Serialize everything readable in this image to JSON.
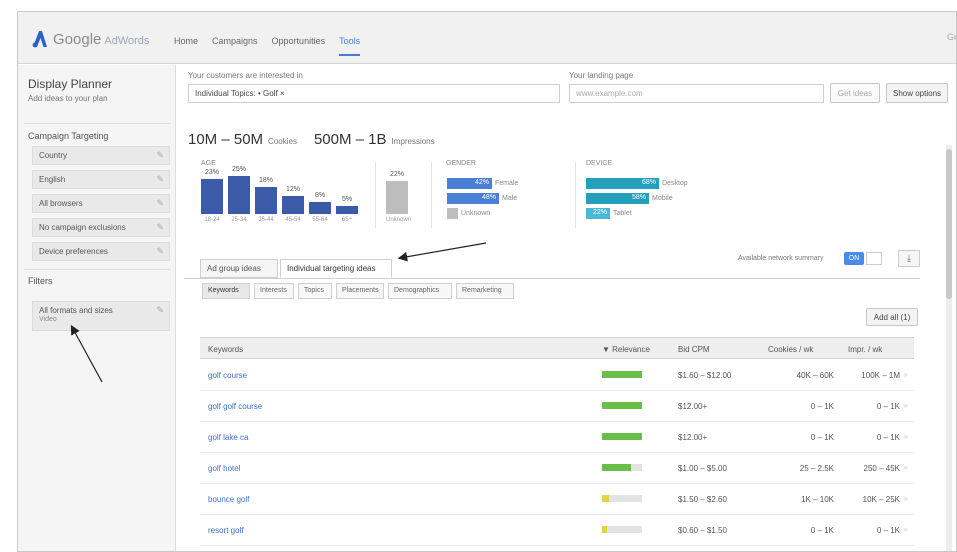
{
  "app": {
    "logo_main": "Google",
    "logo_sub": "AdWords",
    "user": "Gi"
  },
  "nav": [
    {
      "label": "Home",
      "active": false
    },
    {
      "label": "Campaigns",
      "active": false
    },
    {
      "label": "Opportunities",
      "active": false
    },
    {
      "label": "Tools",
      "active": true
    }
  ],
  "sidebar": {
    "title": "Display Planner",
    "subtitle": "Add ideas to your plan",
    "targeting_heading": "Campaign Targeting",
    "targeting_items": [
      "Country",
      "English",
      "All browsers",
      "No campaign exclusions",
      "Device preferences"
    ],
    "filters_heading": "Filters",
    "filter_item": {
      "label": "All formats and sizes",
      "sub": "Video"
    }
  },
  "inputs": {
    "interest_label": "Your customers are interested in",
    "interest_value": "Individual Topics: • Golf ×",
    "landing_label": "Your landing page",
    "landing_placeholder": "www.example.com",
    "get_ideas_label": "Get ideas",
    "show_options_label": "Show options"
  },
  "stats": {
    "cookies_value": "10M – 50M",
    "cookies_label": "Cookies",
    "impressions_value": "500M – 1B",
    "impressions_label": "Impressions",
    "age_label": "AGE",
    "gender_label": "GENDER",
    "device_label": "DEVICE"
  },
  "chart_data": [
    {
      "type": "bar",
      "title": "AGE",
      "categories": [
        "18-24",
        "25-34",
        "35-44",
        "45-54",
        "55-64",
        "65+"
      ],
      "values": [
        23,
        25,
        18,
        12,
        8,
        5
      ],
      "value_labels": [
        "23%",
        "25%",
        "18%",
        "12%",
        "8%",
        "5%"
      ],
      "extra_bar": {
        "category": "Unknown",
        "value": 22,
        "label": "22%"
      },
      "ylim": [
        0,
        25
      ]
    },
    {
      "type": "bar",
      "orientation": "horizontal",
      "title": "GENDER",
      "categories": [
        "Female",
        "Male",
        "Unknown"
      ],
      "values": [
        42,
        48,
        10
      ],
      "value_labels": [
        "42%",
        "48%",
        ""
      ],
      "colors": [
        "#4a7fd6",
        "#4a7fd6",
        "#bdbdbd"
      ]
    },
    {
      "type": "bar",
      "orientation": "horizontal",
      "title": "DEVICE",
      "categories": [
        "Desktop",
        "Mobile",
        "Tablet"
      ],
      "values": [
        68,
        58,
        22
      ],
      "value_labels": [
        "68%",
        "58%",
        "22%"
      ],
      "colors": [
        "#24a0bd",
        "#24a0bd",
        "#4ab8d8"
      ]
    }
  ],
  "tabs": [
    {
      "label": "Ad group ideas",
      "active": false
    },
    {
      "label": "Individual targeting ideas",
      "active": true
    }
  ],
  "subtabs": [
    "Keywords",
    "Interests",
    "Topics",
    "Placements",
    "Demographics",
    "Remarketing"
  ],
  "toggle": {
    "label": "Available network summary",
    "value": "ON"
  },
  "add_all_label": "Add all (1)",
  "table": {
    "columns": [
      "Keywords",
      "▼ Relevance",
      "Bid CPM",
      "Cookies / wk",
      "Impr. / wk"
    ],
    "rows": [
      {
        "keyword": "golf course",
        "relevance": 1.0,
        "color": "#6abf4b",
        "bid": "$1.60 – $12.00",
        "cookies": "40K – 60K",
        "impr": "100K – 1M"
      },
      {
        "keyword": "golf golf course",
        "relevance": 1.0,
        "color": "#6abf4b",
        "bid": "$12.00+",
        "cookies": "0 – 1K",
        "impr": "0 – 1K"
      },
      {
        "keyword": "golf lake ca",
        "relevance": 1.0,
        "color": "#6abf4b",
        "bid": "$12.00+",
        "cookies": "0 – 1K",
        "impr": "0 – 1K"
      },
      {
        "keyword": "golf hotel",
        "relevance": 0.72,
        "color": "#6abf4b",
        "bid": "$1.00 – $5.00",
        "cookies": "25 – 2.5K",
        "impr": "250 – 45K"
      },
      {
        "keyword": "bounce golf",
        "relevance": 0.18,
        "color": "#e4d445",
        "bid": "$1.50 – $2.60",
        "cookies": "1K – 10K",
        "impr": "10K – 25K"
      },
      {
        "keyword": "resort golf",
        "relevance": 0.12,
        "color": "#e4d445",
        "bid": "$0.60 – $1.50",
        "cookies": "0 – 1K",
        "impr": "0 – 1K"
      }
    ]
  }
}
